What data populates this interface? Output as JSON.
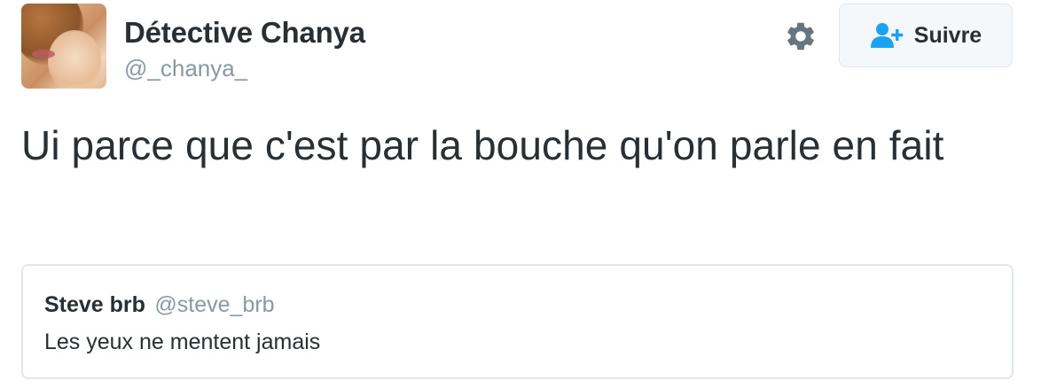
{
  "tweet": {
    "author": {
      "display_name": "Détective Chanya",
      "handle": "@_chanya_",
      "avatar_icon": "profile-photo"
    },
    "settings_icon": "gear-icon",
    "follow_button": {
      "label": "Suivre",
      "icon": "add-user-icon",
      "icon_color": "#1da1f2"
    },
    "text": "Ui parce que c'est par la bouche qu'on parle en fait",
    "quoted_tweet": {
      "author_name": "Steve brb",
      "author_handle": "@steve_brb",
      "text": "Les yeux ne mentent jamais"
    }
  },
  "colors": {
    "text_primary": "#292f33",
    "text_secondary": "#8899a6",
    "border": "#e1e8ed",
    "accent": "#1da1f2",
    "icon_gray": "#66757f"
  }
}
